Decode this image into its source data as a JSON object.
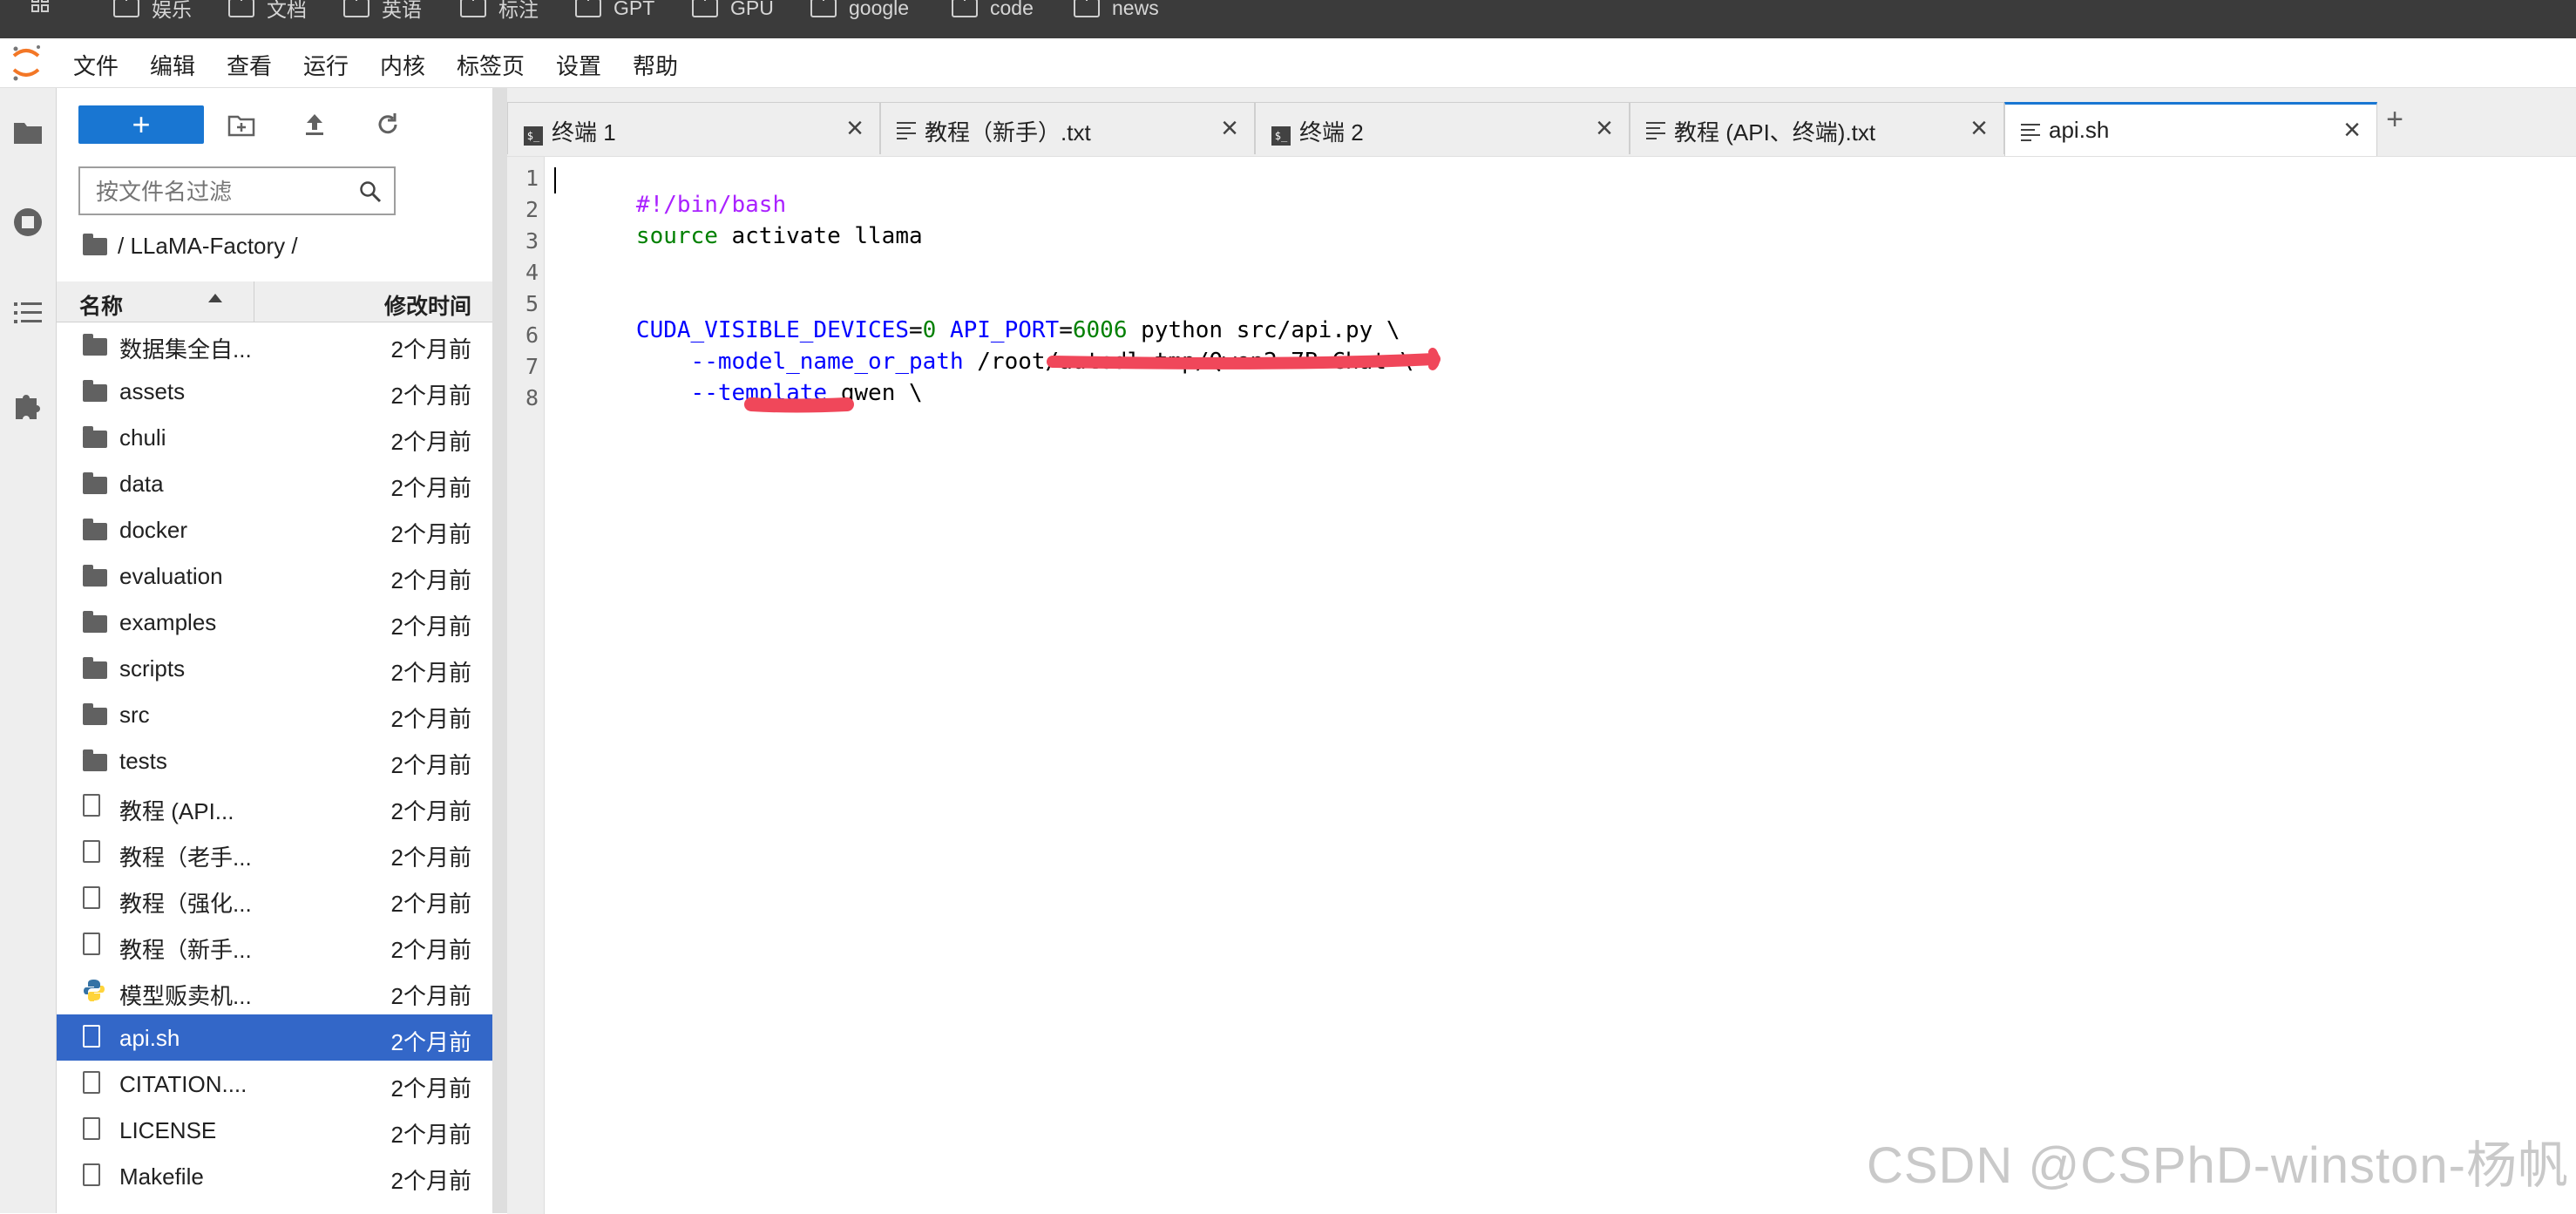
{
  "bookmarks": [
    "娱乐",
    "文档",
    "英语",
    "标注",
    "GPT",
    "GPU",
    "google",
    "code",
    "news"
  ],
  "menu": [
    "文件",
    "编辑",
    "查看",
    "运行",
    "内核",
    "标签页",
    "设置",
    "帮助"
  ],
  "filebrowser": {
    "new_label": "+",
    "filter_placeholder": "按文件名过滤",
    "breadcrumb": "/ LLaMA-Factory /",
    "col_name": "名称",
    "col_modified": "修改时间",
    "files": [
      {
        "name": "数据集全自...",
        "modified": "2个月前",
        "type": "folder"
      },
      {
        "name": "assets",
        "modified": "2个月前",
        "type": "folder"
      },
      {
        "name": "chuli",
        "modified": "2个月前",
        "type": "folder"
      },
      {
        "name": "data",
        "modified": "2个月前",
        "type": "folder"
      },
      {
        "name": "docker",
        "modified": "2个月前",
        "type": "folder"
      },
      {
        "name": "evaluation",
        "modified": "2个月前",
        "type": "folder"
      },
      {
        "name": "examples",
        "modified": "2个月前",
        "type": "folder"
      },
      {
        "name": "scripts",
        "modified": "2个月前",
        "type": "folder"
      },
      {
        "name": "src",
        "modified": "2个月前",
        "type": "folder"
      },
      {
        "name": "tests",
        "modified": "2个月前",
        "type": "folder"
      },
      {
        "name": "教程 (API...",
        "modified": "2个月前",
        "type": "file"
      },
      {
        "name": "教程（老手...",
        "modified": "2个月前",
        "type": "file"
      },
      {
        "name": "教程（强化...",
        "modified": "2个月前",
        "type": "file"
      },
      {
        "name": "教程（新手...",
        "modified": "2个月前",
        "type": "file"
      },
      {
        "name": "模型贩卖机...",
        "modified": "2个月前",
        "type": "python"
      },
      {
        "name": "api.sh",
        "modified": "2个月前",
        "type": "file",
        "selected": true
      },
      {
        "name": "CITATION....",
        "modified": "2个月前",
        "type": "file"
      },
      {
        "name": "LICENSE",
        "modified": "2个月前",
        "type": "file"
      },
      {
        "name": "Makefile",
        "modified": "2个月前",
        "type": "file"
      }
    ]
  },
  "tabs": [
    {
      "label": "终端 1",
      "icon": "terminal-icon"
    },
    {
      "label": "教程（新手）.txt",
      "icon": "text-file-icon"
    },
    {
      "label": "终端 2",
      "icon": "terminal-icon"
    },
    {
      "label": "教程 (API、终端).txt",
      "icon": "text-file-icon"
    },
    {
      "label": "api.sh",
      "icon": "text-file-icon",
      "active": true
    }
  ],
  "add_tab": "+",
  "editor": {
    "line_numbers": [
      "1",
      "2",
      "3",
      "4",
      "5",
      "6",
      "7",
      "8"
    ],
    "l1": "#!/bin/bash",
    "l2_kw": "source",
    "l2_rest": " activate llama",
    "l5_v1": "CUDA_VISIBLE_DEVICES",
    "l5_eq1": "=",
    "l5_n1": "0",
    "l5_v2": " API_PORT",
    "l5_eq2": "=",
    "l5_n2": "6006",
    "l5_rest": " python src/api.py \\",
    "l6_flag": "    --model_name_or_path",
    "l6_rest": " /root/autodl-tmp/Qwen2-7B-Chat \\",
    "l7_flag": "    --template",
    "l7_rest": " qwen \\"
  },
  "watermark": "CSDN @CSPhD-winston-杨帆",
  "colors": {
    "accent": "#1976d2",
    "selected_row": "#3367c8",
    "annotation": "#f0475a"
  }
}
